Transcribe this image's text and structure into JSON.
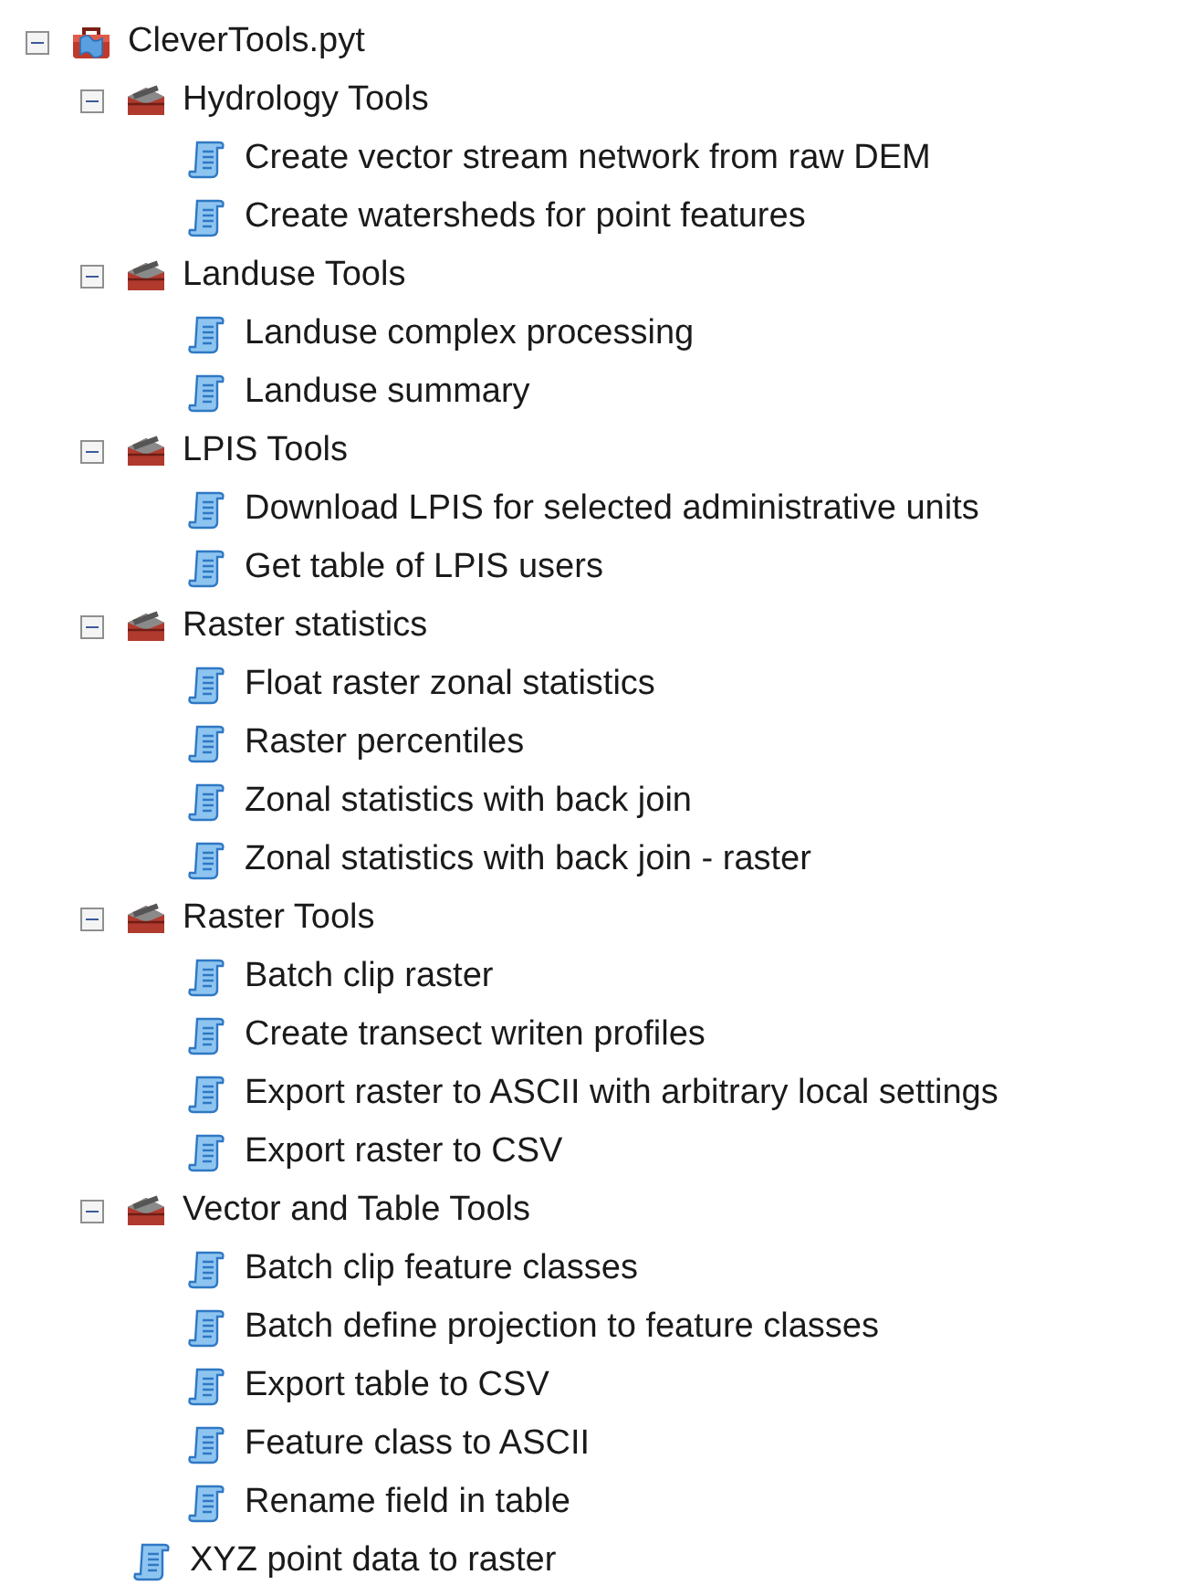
{
  "tree": {
    "label": "CleverTools.pyt",
    "kind": "toolbox",
    "expanded": true,
    "children": [
      {
        "label": "Hydrology Tools",
        "kind": "toolset",
        "expanded": true,
        "children": [
          {
            "label": "Create vector stream network from raw DEM",
            "kind": "script"
          },
          {
            "label": "Create watersheds for point features",
            "kind": "script"
          }
        ]
      },
      {
        "label": "Landuse Tools",
        "kind": "toolset",
        "expanded": true,
        "children": [
          {
            "label": "Landuse complex processing",
            "kind": "script"
          },
          {
            "label": "Landuse summary",
            "kind": "script"
          }
        ]
      },
      {
        "label": "LPIS Tools",
        "kind": "toolset",
        "expanded": true,
        "children": [
          {
            "label": "Download LPIS for selected administrative units",
            "kind": "script"
          },
          {
            "label": "Get table of LPIS users",
            "kind": "script"
          }
        ]
      },
      {
        "label": "Raster statistics",
        "kind": "toolset",
        "expanded": true,
        "children": [
          {
            "label": "Float raster zonal statistics",
            "kind": "script"
          },
          {
            "label": "Raster percentiles",
            "kind": "script"
          },
          {
            "label": "Zonal statistics with back join",
            "kind": "script"
          },
          {
            "label": "Zonal statistics with back join - raster",
            "kind": "script"
          }
        ]
      },
      {
        "label": "Raster Tools",
        "kind": "toolset",
        "expanded": true,
        "children": [
          {
            "label": "Batch clip raster",
            "kind": "script"
          },
          {
            "label": "Create transect writen profiles",
            "kind": "script"
          },
          {
            "label": "Export raster to ASCII with arbitrary local settings",
            "kind": "script"
          },
          {
            "label": "Export raster to CSV",
            "kind": "script"
          }
        ]
      },
      {
        "label": "Vector and Table Tools",
        "kind": "toolset",
        "expanded": true,
        "children": [
          {
            "label": "Batch clip feature classes",
            "kind": "script"
          },
          {
            "label": "Batch define projection to feature classes",
            "kind": "script"
          },
          {
            "label": "Export table to CSV",
            "kind": "script"
          },
          {
            "label": "Feature class to ASCII",
            "kind": "script"
          },
          {
            "label": "Rename field in table",
            "kind": "script"
          }
        ]
      },
      {
        "label": "XYZ point data to raster",
        "kind": "script"
      }
    ]
  }
}
